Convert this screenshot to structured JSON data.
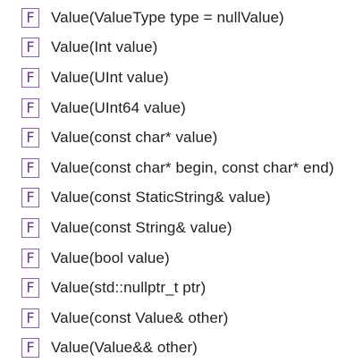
{
  "functions": {
    "badge_letter": "F",
    "items": [
      {
        "signature": "Value(ValueType type = nullValue)"
      },
      {
        "signature": "Value(Int value)"
      },
      {
        "signature": "Value(UInt value)"
      },
      {
        "signature": "Value(UInt64 value)"
      },
      {
        "signature": "Value(const char* value)"
      },
      {
        "signature": "Value(const char* begin, const char* end)"
      },
      {
        "signature": "Value(const StaticString& value)"
      },
      {
        "signature": "Value(const String& value)"
      },
      {
        "signature": "Value(bool value)"
      },
      {
        "signature": "Value(std::nullptr_t ptr)"
      },
      {
        "signature": "Value(const Value& other)"
      },
      {
        "signature": "Value(Value&& other)"
      }
    ]
  },
  "colors": {
    "badge_border": "#8e5bb8",
    "badge_text": "#6a2f97",
    "label_text": "#1f1f1f"
  }
}
